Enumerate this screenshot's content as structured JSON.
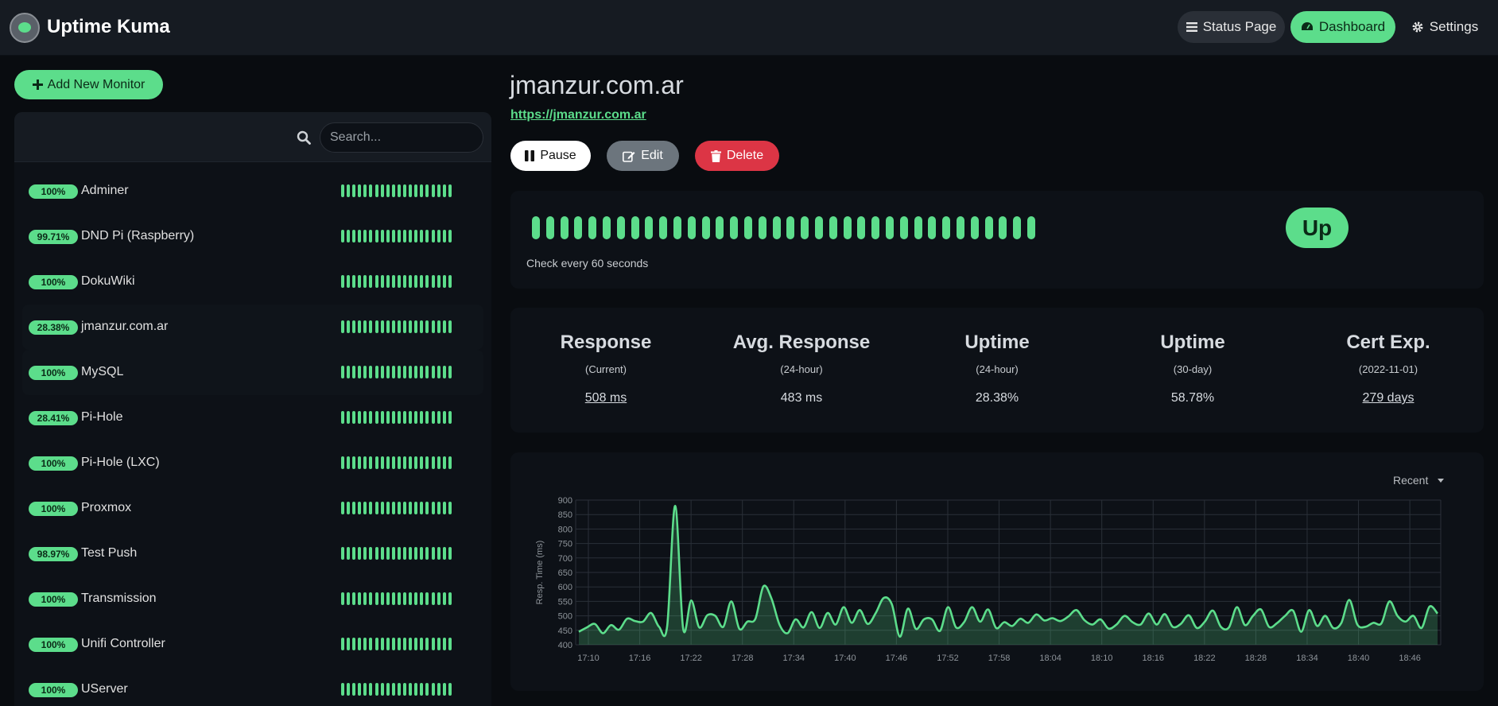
{
  "header": {
    "brand": "Uptime Kuma",
    "nav": {
      "status_page": "Status Page",
      "dashboard": "Dashboard",
      "settings": "Settings"
    }
  },
  "sidebar": {
    "add_button": "Add New Monitor",
    "search_placeholder": "Search...",
    "monitors": [
      {
        "badge": "100%",
        "name": "Adminer"
      },
      {
        "badge": "99.71%",
        "name": "DND Pi (Raspberry)"
      },
      {
        "badge": "100%",
        "name": "DokuWiki"
      },
      {
        "badge": "28.38%",
        "name": "jmanzur.com.ar"
      },
      {
        "badge": "100%",
        "name": "MySQL"
      },
      {
        "badge": "28.41%",
        "name": "Pi-Hole"
      },
      {
        "badge": "100%",
        "name": "Pi-Hole (LXC)"
      },
      {
        "badge": "100%",
        "name": "Proxmox"
      },
      {
        "badge": "98.97%",
        "name": "Test Push"
      },
      {
        "badge": "100%",
        "name": "Transmission"
      },
      {
        "badge": "100%",
        "name": "Unifi Controller"
      },
      {
        "badge": "100%",
        "name": "UServer"
      }
    ]
  },
  "monitor": {
    "title": "jmanzur.com.ar",
    "url": "https://jmanzur.com.ar",
    "actions": {
      "pause": "Pause",
      "edit": "Edit",
      "delete": "Delete"
    },
    "check_text": "Check every 60 seconds",
    "status": "Up",
    "stats": [
      {
        "title": "Response",
        "sub": "(Current)",
        "value": "508 ms"
      },
      {
        "title": "Avg. Response",
        "sub": "(24-hour)",
        "value": "483 ms"
      },
      {
        "title": "Uptime",
        "sub": "(24-hour)",
        "value": "28.38%"
      },
      {
        "title": "Uptime",
        "sub": "(30-day)",
        "value": "58.78%"
      },
      {
        "title": "Cert Exp.",
        "sub": "(2022-11-01)",
        "value": "279 days"
      }
    ],
    "period": "Recent"
  },
  "colors": {
    "accent": "#5cdd8b",
    "danger": "#dc3545",
    "secondary": "#6c757d",
    "card": "#0d1117",
    "background": "#090c10"
  },
  "chart_data": {
    "type": "area",
    "title": "",
    "xlabel": "",
    "ylabel": "Resp. Time (ms)",
    "ylim": [
      400,
      900
    ],
    "yticks": [
      400,
      450,
      500,
      550,
      600,
      650,
      700,
      750,
      800,
      850,
      900
    ],
    "xtick_labels": [
      "17:10",
      "17:16",
      "17:22",
      "17:28",
      "17:34",
      "17:40",
      "17:46",
      "17:52",
      "17:58",
      "18:04",
      "18:10",
      "18:16",
      "18:22",
      "18:28",
      "18:34",
      "18:40",
      "18:46"
    ],
    "x_minutes_start": "17:09",
    "series": [
      {
        "values": [
          445,
          460,
          472,
          440,
          468,
          452,
          490,
          482,
          480,
          510,
          462,
          463,
          880,
          455,
          553,
          460,
          502,
          500,
          462,
          550,
          455,
          480,
          490,
          602,
          560,
          470,
          440,
          488,
          460,
          513,
          458,
          510,
          470,
          530,
          476,
          520,
          472,
          510,
          562,
          540,
          428,
          525,
          455,
          488,
          488,
          448,
          530,
          460,
          478,
          530,
          480,
          522,
          458,
          478,
          465,
          490,
          476,
          505,
          484,
          492,
          482,
          498,
          520,
          485,
          470,
          488,
          456,
          470,
          500,
          478,
          470,
          508,
          470,
          506,
          462,
          472,
          502,
          458,
          480,
          518,
          462,
          460,
          530,
          468,
          500,
          522,
          462,
          475,
          500,
          518,
          445,
          520,
          465,
          500,
          458,
          475,
          555,
          470,
          462,
          476,
          474,
          550,
          500,
          480,
          500,
          458,
          532,
          508
        ]
      }
    ]
  }
}
